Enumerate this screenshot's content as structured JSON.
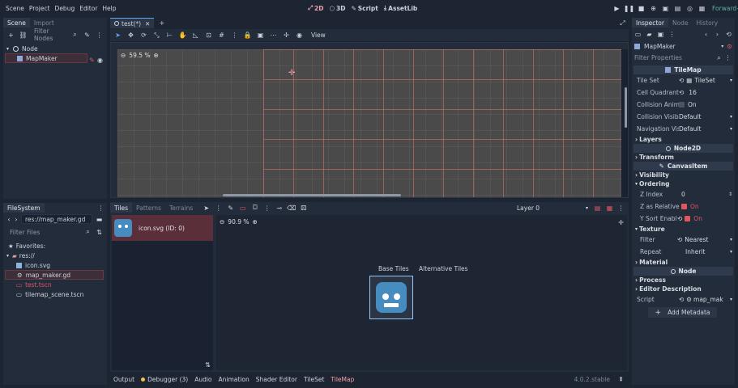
{
  "menu": {
    "items": [
      "Scene",
      "Project",
      "Debug",
      "Editor",
      "Help"
    ]
  },
  "modes": {
    "d2": "2D",
    "d3": "3D",
    "script": "Script",
    "assetlib": "AssetLib"
  },
  "renderer": "Forward+",
  "scene_dock": {
    "tabs": [
      "Scene",
      "Import"
    ],
    "filter_placeholder": "Filter Nodes",
    "nodes": [
      "Node",
      "MapMaker"
    ]
  },
  "editor_tab": {
    "label": "test(*)"
  },
  "toolbar": {
    "view": "View",
    "zoom": "59.5 %"
  },
  "filesystem": {
    "title": "FileSystem",
    "path": "res://map_maker.gd",
    "filter_placeholder": "Filter Files",
    "favorites": "Favorites:",
    "root": "res://",
    "files": [
      "icon.svg",
      "map_maker.gd",
      "test.tscn",
      "tilemap_scene.tscn"
    ]
  },
  "tiles": {
    "tabs": [
      "Tiles",
      "Patterns",
      "Terrains"
    ],
    "layer": "Layer 0",
    "source": "icon.svg (ID: 0)",
    "zoom": "90.9 %",
    "base_tiles": "Base Tiles",
    "alt_tiles": "Alternative Tiles"
  },
  "bottom_bar": {
    "tabs": [
      "Output",
      "Debugger (3)",
      "Audio",
      "Animation",
      "Shader Editor",
      "TileSet",
      "TileMap"
    ],
    "version": "4.0.2.stable"
  },
  "inspector": {
    "tabs": [
      "Inspector",
      "Node",
      "History"
    ],
    "object": "MapMaker",
    "filter_placeholder": "Filter Properties",
    "class_tilemap": "TileMap",
    "tile_set_label": "Tile Set",
    "tile_set_value": "TileSet",
    "quadrant_label": "Cell Quadrant S...",
    "quadrant_value": "16",
    "collision_anim_label": "Collision Anima...",
    "collision_anim_value": "On",
    "collision_vis_label": "Collision Visibili...",
    "collision_vis_value": "Default",
    "nav_vis_label": "Navigation Visi...",
    "nav_vis_value": "Default",
    "layers": "Layers",
    "class_node2d": "Node2D",
    "transform": "Transform",
    "class_canvasitem": "CanvasItem",
    "visibility": "Visibility",
    "ordering": "Ordering",
    "z_index_label": "Z Index",
    "z_index_value": "0",
    "z_relative_label": "Z as Relative",
    "z_relative_value": "On",
    "ysort_label": "Y Sort Enabl...",
    "ysort_value": "On",
    "texture": "Texture",
    "filter_label": "Filter",
    "filter_value": "Nearest",
    "repeat_label": "Repeat",
    "repeat_value": "Inherit",
    "material": "Material",
    "class_node": "Node",
    "process": "Process",
    "editor_desc": "Editor Description",
    "script_label": "Script",
    "script_value": "map_mak",
    "add_metadata": "Add Metadata"
  },
  "colors": {
    "accent": "#5fa8f5",
    "warn": "#f0c050",
    "err": "#e05660",
    "mode_active": "#f0a0a8"
  }
}
